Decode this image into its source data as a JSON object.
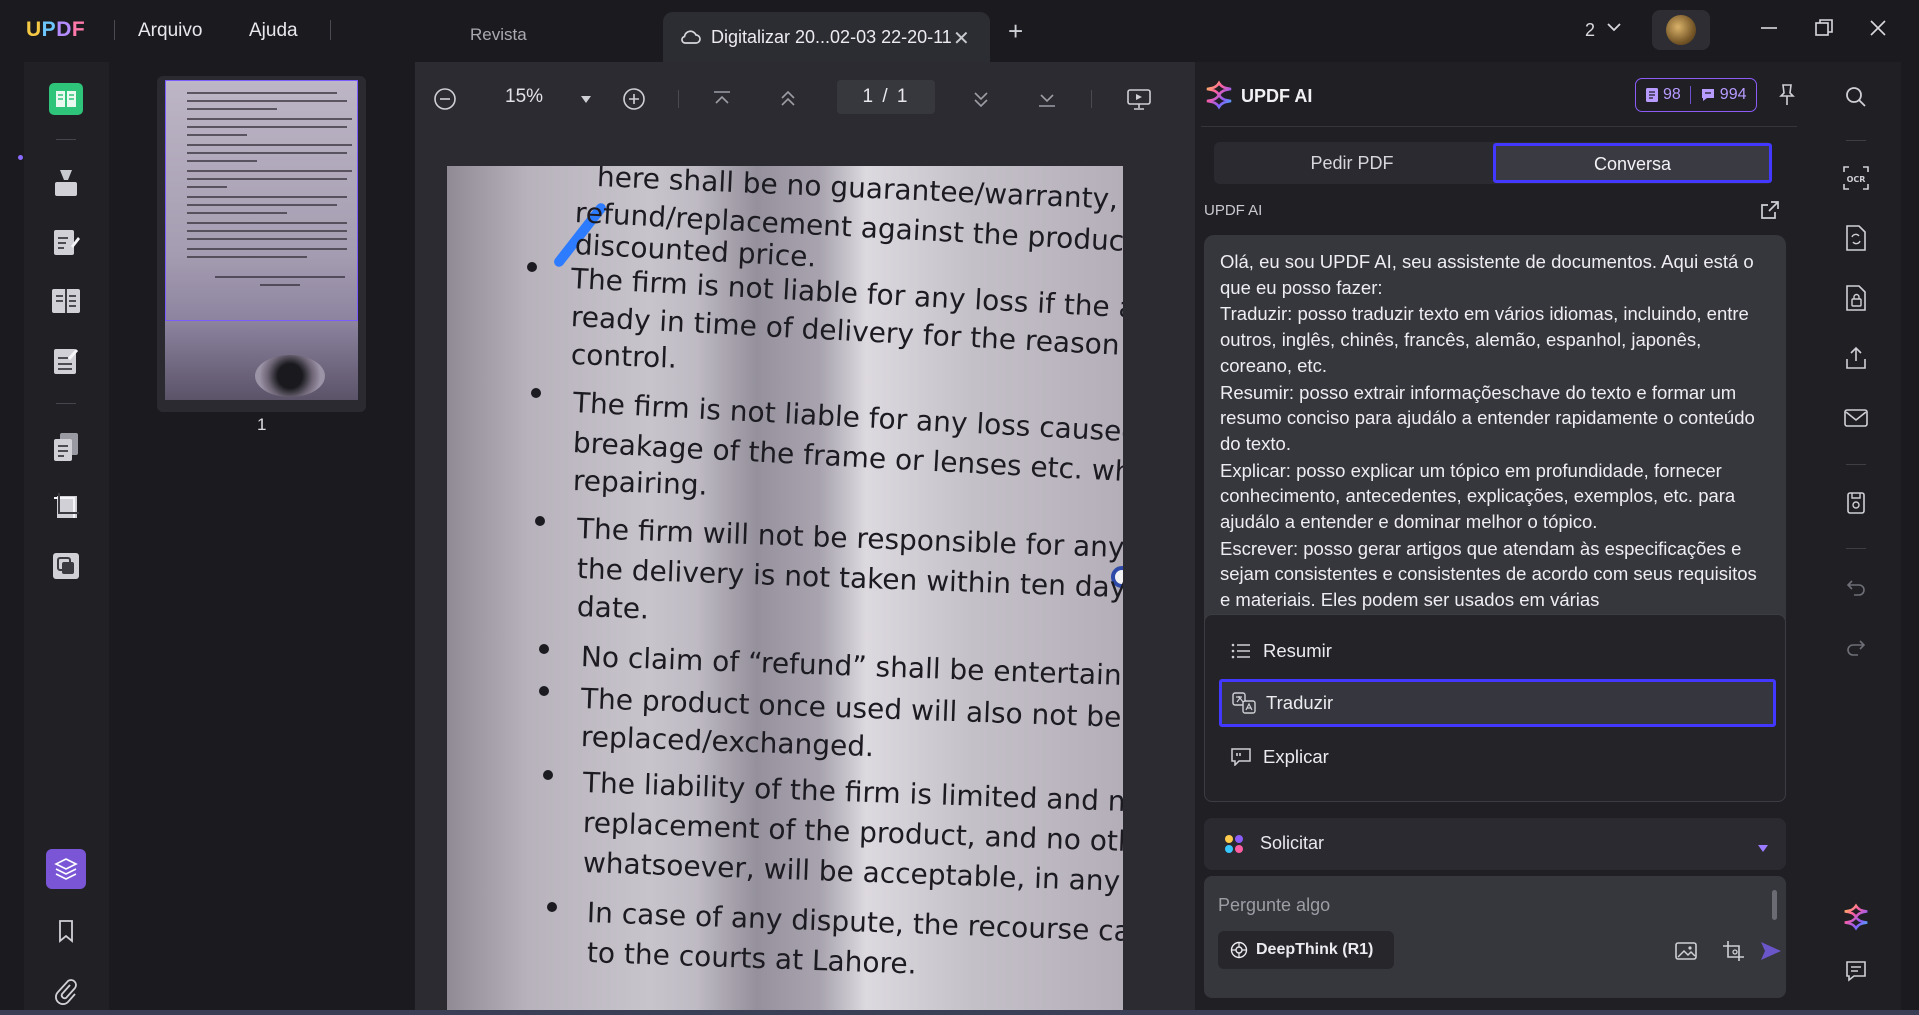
{
  "app": {
    "logo": "UPDF",
    "menu": [
      "Arquivo",
      "Ajuda"
    ]
  },
  "tabs": {
    "inactive": "Revista",
    "active": "Digitalizar 20...02-03 22-20-11",
    "add_label": "+"
  },
  "window": {
    "count": "2"
  },
  "viewer": {
    "zoom": "15%",
    "page_indicator": "1 / 1",
    "thumbnail_page": "1",
    "document_lines": [
      "here shall be no guarantee/warranty,",
      "refund/replacement against the products so",
      "discounted price.",
      "The firm is not liable for any loss if the artic",
      "ready in time of delivery for the reason bey",
      "control.",
      "The firm is not liable for any loss caused by",
      "breakage of the frame or lenses etc. while",
      "repairing.",
      "The firm will not be responsible for any lo",
      "the delivery is not taken within ten days o",
      "date.",
      "No claim of “refund” shall be entertained",
      "The product once used will also not be",
      "replaced/exchanged.",
      "The liability of the firm is limited and not",
      "replacement of the product, and no othe",
      "whatsoever, will be acceptable, in any ca",
      "In case of any dispute, the recourse can",
      "to the courts at Lahore."
    ]
  },
  "ai": {
    "title": "UPDF AI",
    "credits_docs": "98",
    "credits_chat": "994",
    "tabs": {
      "pdf": "Pedir PDF",
      "chat": "Conversa"
    },
    "section_label": "UPDF AI",
    "message": [
      "Olá, eu sou UPDF AI, seu assistente de documentos. Aqui está o que eu posso fazer:",
      "Traduzir: posso traduzir texto em vários idiomas, incluindo, entre outros, inglês, chinês, francês, alemão, espanhol, japonês, coreano, etc.",
      "Resumir: posso extrair informaçõeschave do texto e formar um resumo conciso para ajudálo a entender rapidamente o conteúdo do texto.",
      "Explicar: posso explicar um tópico em profundidade, fornecer conhecimento, antecedentes, explicações, exemplos, etc. para ajudálo a entender e dominar melhor o tópico.",
      "Escrever: posso gerar artigos que atendam às especificações e sejam consistentes e consistentes de acordo com seus requisitos e materiais. Eles podem ser usados em várias"
    ],
    "suggestions": [
      "Resumir",
      "Traduzir",
      "Explicar"
    ],
    "prompt_label": "Solicitar",
    "input_placeholder": "Pergunte algo",
    "deepthink_label": "DeepThink (R1)"
  },
  "colors": {
    "accent": "#4338ff",
    "brand_purple": "#8b5cf6",
    "rail_active": "#2ec47a"
  }
}
